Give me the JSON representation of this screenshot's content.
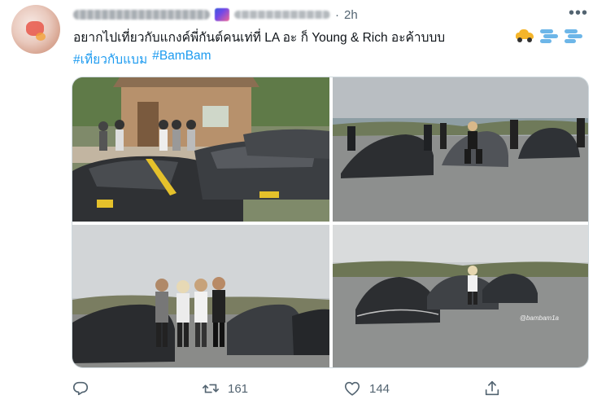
{
  "tweet": {
    "time": "2h",
    "separator": "·",
    "text": "อยากไปเที่ยวกับแกงค์พี่กันต์คนเท่ที่ LA อะ ก็ Young & Rich อะค้าบบบ",
    "hashtags": [
      "#เที่ยวกับแบม",
      "#BamBam"
    ],
    "more_label": "•••",
    "media_watermark": "@bambam1a"
  },
  "actions": {
    "reply_count": "",
    "retweet_count": "161",
    "like_count": "144"
  },
  "icons": {
    "reply": "reply-icon",
    "retweet": "retweet-icon",
    "like": "heart-icon",
    "share": "share-icon",
    "more": "more-icon",
    "badge": "badge-icon"
  },
  "colors": {
    "link": "#1d9bf0",
    "muted": "#536471",
    "text": "#0f1419"
  }
}
